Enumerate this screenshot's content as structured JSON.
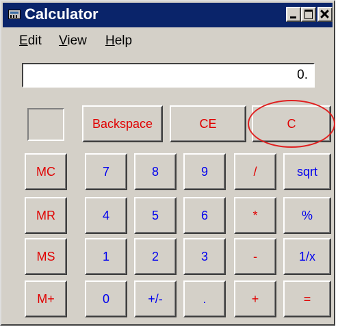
{
  "window": {
    "title": "Calculator"
  },
  "menu": [
    {
      "accel": "E",
      "rest": "dit"
    },
    {
      "accel": "V",
      "rest": "iew"
    },
    {
      "accel": "H",
      "rest": "elp"
    }
  ],
  "display": {
    "value": "0."
  },
  "buttons": {
    "backspace": "Backspace",
    "ce": "CE",
    "c": "C",
    "mc": "MC",
    "mr": "MR",
    "ms": "MS",
    "mplus": "M+",
    "n7": "7",
    "n8": "8",
    "n9": "9",
    "div": "/",
    "sqrt": "sqrt",
    "n4": "4",
    "n5": "5",
    "n6": "6",
    "mul": "*",
    "pct": "%",
    "n1": "1",
    "n2": "2",
    "n3": "3",
    "sub": "-",
    "inv": "1/x",
    "n0": "0",
    "sign": "+/-",
    "dot": ".",
    "add": "+",
    "eq": "="
  },
  "highlight": {
    "target": "c-button",
    "color": "#e02020"
  },
  "colors": {
    "titlebar": "#0a246a",
    "face": "#d4d0c8",
    "digit": "#0000ee",
    "op": "#e00000"
  },
  "icons": {
    "app": "calculator-icon"
  }
}
